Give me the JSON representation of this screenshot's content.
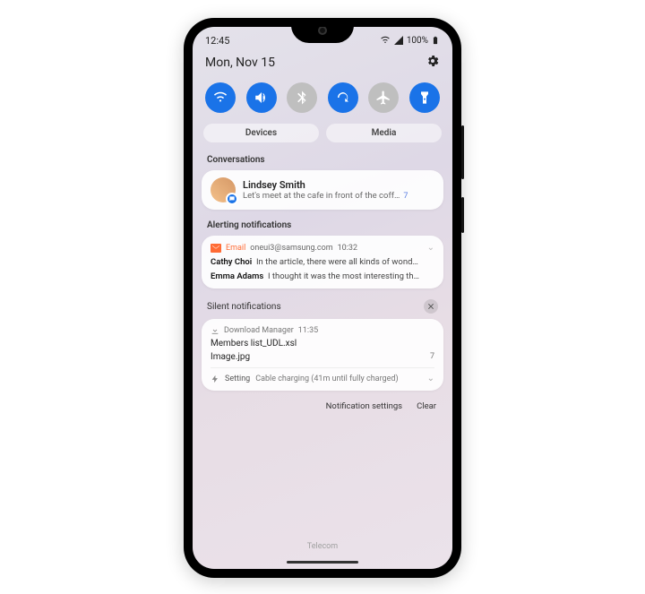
{
  "status": {
    "time": "12:45",
    "battery_pct": "100%"
  },
  "date": "Mon, Nov 15",
  "quick_settings": [
    {
      "name": "wifi",
      "on": true
    },
    {
      "name": "sound",
      "on": true
    },
    {
      "name": "bluetooth",
      "on": false
    },
    {
      "name": "rotate",
      "on": true
    },
    {
      "name": "airplane",
      "on": false
    },
    {
      "name": "flashlight",
      "on": true
    }
  ],
  "pills": {
    "devices": "Devices",
    "media": "Media"
  },
  "sections": {
    "conversations": "Conversations",
    "alerting": "Alerting notifications",
    "silent": "Silent notifications"
  },
  "conversation": {
    "name": "Lindsey Smith",
    "preview": "Let's meet at the cafe in front of the coff…",
    "count": "7"
  },
  "alerting": {
    "app": "Email",
    "sender": "oneui3@samsung.com",
    "time": "10:32",
    "items": [
      {
        "from": "Cathy Choi",
        "text": "In the article, there were all kinds of wond…"
      },
      {
        "from": "Emma Adams",
        "text": "I thought it was the most interesting th…"
      }
    ]
  },
  "silent": {
    "download": {
      "app": "Download Manager",
      "time": "11:35",
      "file1": "Members list_UDL.xsl",
      "file2": "Image.jpg",
      "count": "7"
    },
    "setting": {
      "app": "Setting",
      "text": "Cable charging (41m until fully charged)"
    }
  },
  "footer": {
    "settings": "Notification settings",
    "clear": "Clear"
  },
  "carrier": "Telecom"
}
